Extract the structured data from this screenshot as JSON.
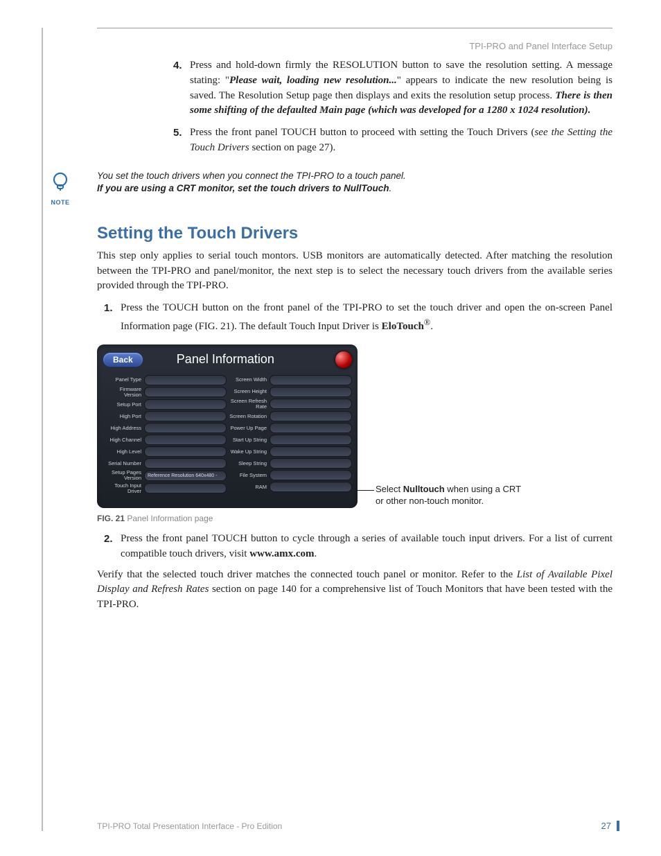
{
  "header": {
    "section_title": "TPI-PRO and Panel Interface Setup"
  },
  "list": {
    "item4": {
      "num": "4.",
      "pre": "Press and hold-down firmly the RESOLUTION button to save the resolution setting. A message stating: \"",
      "quoted": "Please wait, loading new resolution...",
      "mid": "\" appears to indicate the new resolution being is saved. The Resolution Setup page then displays and exits the resolution setup process. ",
      "bold_tail": "There is then some shifting of the defaulted Main page (which was developed for a 1280 x 1024 resolution)."
    },
    "item5": {
      "num": "5.",
      "pre": "Press the front panel TOUCH button to proceed with setting the Touch Drivers (",
      "ital": "see the Setting the Touch Drivers",
      "post": " section on page 27)."
    }
  },
  "note": {
    "label": "NOTE",
    "line1": "You set the touch drivers when you connect the TPI-PRO to a touch panel.",
    "line2_strong": "If you are using a CRT monitor, set the touch drivers to NullTouch",
    "line2_tail": "."
  },
  "section_heading": "Setting the Touch Drivers",
  "intro_para": "This step only applies to serial touch montors. USB monitors are automatically detected. After matching the resolution between the TPI-PRO and panel/monitor, the next step is to select the necessary touch drivers from the available series provided through the TPI-PRO.",
  "step1": {
    "num": "1.",
    "text_pre": "Press the TOUCH button on the front panel of the TPI-PRO to set the touch driver and open the on-screen Panel Information page (FIG. 21). The default Touch Input Driver is ",
    "bold": "EloTouch",
    "sup": "®",
    "tail": "."
  },
  "panel": {
    "back": "Back",
    "title": "Panel Information",
    "left_labels": [
      "Panel Type",
      "Firmware Version",
      "Setup Port",
      "High Port",
      "High Address",
      "High Channel",
      "High Level",
      "Serial Number",
      "Setup Pages Version",
      "Touch Input Driver"
    ],
    "left_values": [
      "",
      "",
      "",
      "",
      "",
      "",
      "",
      "",
      "Reference Resolution 640x480 -",
      ""
    ],
    "right_labels": [
      "Screen Width",
      "Screen Height",
      "Screen Refresh Rate",
      "Screen Rotation",
      "Power Up Page",
      "Start Up String",
      "Wake Up String",
      "Sleep String",
      "File System",
      "RAM"
    ],
    "right_values": [
      "",
      "",
      "",
      "",
      "",
      "",
      "",
      "",
      "",
      ""
    ]
  },
  "callout": {
    "pre": "Select ",
    "bold": "Nulltouch",
    "post": " when using a CRT or other non-touch monitor."
  },
  "fig_caption": {
    "label": "FIG. 21",
    "text": "  Panel Information page"
  },
  "step2": {
    "num": "2.",
    "pre": "Press the front panel TOUCH button to cycle through a series of available touch input drivers. For a list of current compatible touch drivers, visit ",
    "bold": "www.amx.com",
    "tail": "."
  },
  "verify_para": {
    "pre": "Verify that the selected touch driver matches the connected touch panel or monitor. Refer to the ",
    "ital": "List of Available Pixel Display and Refresh Rates",
    "post": " section on page 140 for a comprehensive list of Touch Monitors that have been tested with the TPI-PRO."
  },
  "footer": {
    "left": "TPI-PRO Total Presentation Interface - Pro Edition",
    "page": "27"
  }
}
